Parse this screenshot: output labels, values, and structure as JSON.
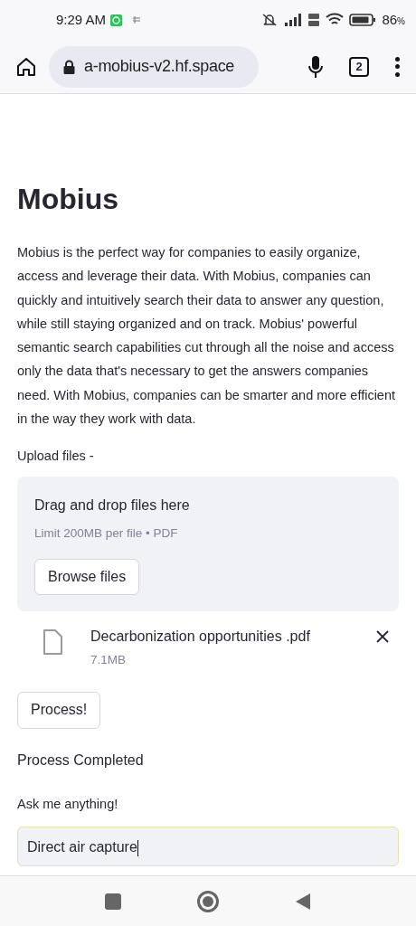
{
  "status_bar": {
    "time": "9:29 AM",
    "battery": "86",
    "battery_unit": "%"
  },
  "browser": {
    "url": "a-mobius-v2.hf.space",
    "tab_count": "2"
  },
  "page": {
    "title": "Mobius",
    "description": "Mobius is the perfect way for companies to easily organize, access and leverage their data. With Mobius, companies can quickly and intuitively search their data to answer any question, while still staying organized and on track. Mobius' powerful semantic search capabilities cut through all the noise and access only the data that's necessary to get the answers companies need. With Mobius, companies can be smarter and more efficient in the way they work with data.",
    "uploader": {
      "label": "Upload files -",
      "drop_text": "Drag and drop files here",
      "limit": "Limit 200MB per file • PDF",
      "browse_button": "Browse files"
    },
    "files": [
      {
        "name": "Decarbonization opportunities .pdf",
        "size": "7.1MB"
      }
    ],
    "process_button": "Process!",
    "status_message": "Process Completed",
    "question": {
      "label": "Ask me anything!",
      "value": "Direct air capture",
      "focused": true
    }
  }
}
